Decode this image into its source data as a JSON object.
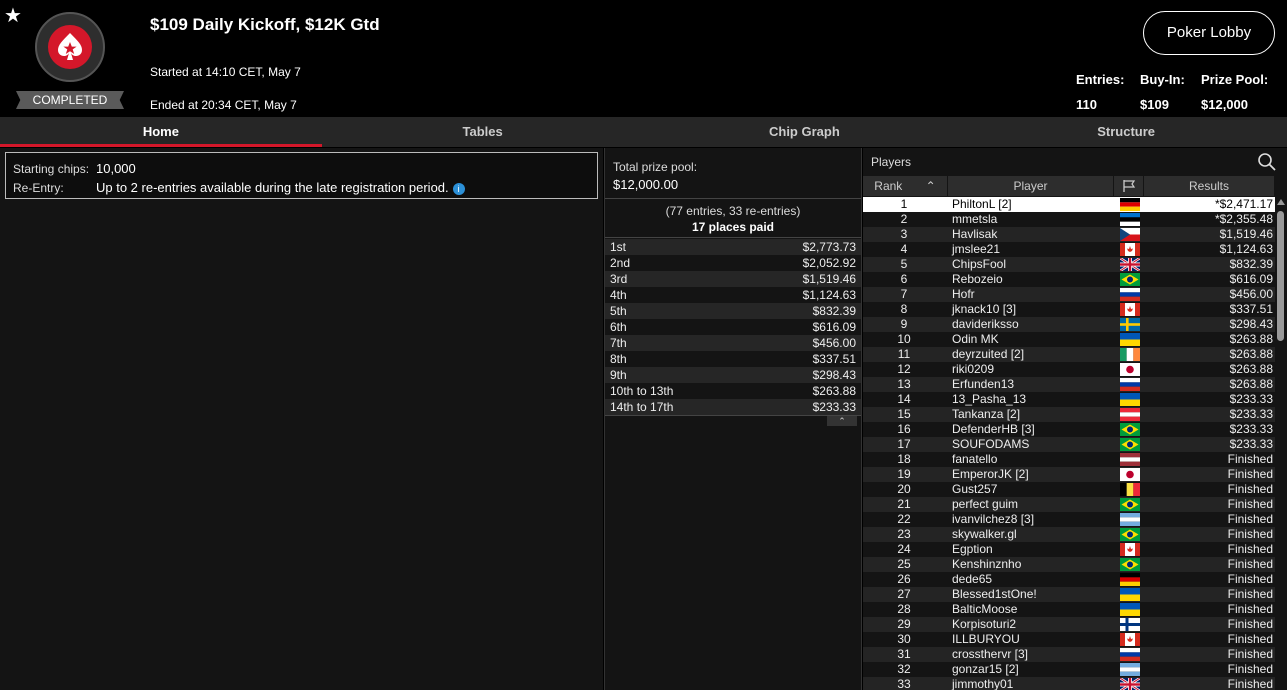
{
  "header": {
    "title": "$109 Daily Kickoff, $12K Gtd",
    "status": "COMPLETED",
    "started": "Started at 14:10 CET, May 7",
    "ended": "Ended at 20:34 CET, May 7",
    "lobby_button": "Poker Lobby",
    "stats": [
      {
        "label": "Entries:",
        "value": "110"
      },
      {
        "label": "Buy-In:",
        "value": "$109"
      },
      {
        "label": "Prize Pool:",
        "value": "$12,000"
      }
    ]
  },
  "tabs": [
    "Home",
    "Tables",
    "Chip Graph",
    "Structure"
  ],
  "info": {
    "starting_chips_label": "Starting chips:",
    "starting_chips_value": "10,000",
    "reentry_label": "Re-Entry:",
    "reentry_value": "Up to 2 re-entries available during the late registration period.",
    "info_icon": "i"
  },
  "prizes": {
    "total_label": "Total prize pool:",
    "total_value": "$12,000.00",
    "entries_text": "(77 entries, 33 re-entries)",
    "places_text": "17 places paid",
    "payouts": [
      {
        "place": "1st",
        "amount": "$2,773.73"
      },
      {
        "place": "2nd",
        "amount": "$2,052.92"
      },
      {
        "place": "3rd",
        "amount": "$1,519.46"
      },
      {
        "place": "4th",
        "amount": "$1,124.63"
      },
      {
        "place": "5th",
        "amount": "$832.39"
      },
      {
        "place": "6th",
        "amount": "$616.09"
      },
      {
        "place": "7th",
        "amount": "$456.00"
      },
      {
        "place": "8th",
        "amount": "$337.51"
      },
      {
        "place": "9th",
        "amount": "$298.43"
      },
      {
        "place": "10th to 13th",
        "amount": "$263.88"
      },
      {
        "place": "14th to 17th",
        "amount": "$233.33"
      }
    ]
  },
  "players": {
    "title": "Players",
    "columns": {
      "rank": "Rank",
      "player": "Player",
      "results": "Results"
    },
    "rows": [
      {
        "rank": "1",
        "name": "PhiltonL [2]",
        "flag": "de",
        "result": "*$2,471.17"
      },
      {
        "rank": "2",
        "name": "mmetsla",
        "flag": "ee",
        "result": "*$2,355.48"
      },
      {
        "rank": "3",
        "name": "Havlisak",
        "flag": "cz",
        "result": "$1,519.46"
      },
      {
        "rank": "4",
        "name": "jmslee21",
        "flag": "ca",
        "result": "$1,124.63"
      },
      {
        "rank": "5",
        "name": "ChipsFool",
        "flag": "gb",
        "result": "$832.39"
      },
      {
        "rank": "6",
        "name": "Rebozeio",
        "flag": "br",
        "result": "$616.09"
      },
      {
        "rank": "7",
        "name": "Hofr",
        "flag": "ru",
        "result": "$456.00"
      },
      {
        "rank": "8",
        "name": "jknack10 [3]",
        "flag": "ca",
        "result": "$337.51"
      },
      {
        "rank": "9",
        "name": "davideriksso",
        "flag": "se",
        "result": "$298.43"
      },
      {
        "rank": "10",
        "name": "Odin MK",
        "flag": "ua",
        "result": "$263.88"
      },
      {
        "rank": "11",
        "name": "deyrzuited [2]",
        "flag": "ie",
        "result": "$263.88"
      },
      {
        "rank": "12",
        "name": "riki0209",
        "flag": "jp",
        "result": "$263.88"
      },
      {
        "rank": "13",
        "name": "Erfunden13",
        "flag": "ru",
        "result": "$263.88"
      },
      {
        "rank": "14",
        "name": "13_Pasha_13",
        "flag": "ua",
        "result": "$233.33"
      },
      {
        "rank": "15",
        "name": "Tankanza [2]",
        "flag": "at",
        "result": "$233.33"
      },
      {
        "rank": "16",
        "name": "DefenderHB [3]",
        "flag": "br",
        "result": "$233.33"
      },
      {
        "rank": "17",
        "name": "SOUFODAMS",
        "flag": "br",
        "result": "$233.33"
      },
      {
        "rank": "18",
        "name": "fanatello",
        "flag": "lv",
        "result": "Finished"
      },
      {
        "rank": "19",
        "name": "EmperorJK [2]",
        "flag": "jp",
        "result": "Finished"
      },
      {
        "rank": "20",
        "name": "Gust257",
        "flag": "be",
        "result": "Finished"
      },
      {
        "rank": "21",
        "name": "perfect guim",
        "flag": "br",
        "result": "Finished"
      },
      {
        "rank": "22",
        "name": "ivanvilchez8 [3]",
        "flag": "ar",
        "result": "Finished"
      },
      {
        "rank": "23",
        "name": "skywalker.gl",
        "flag": "br",
        "result": "Finished"
      },
      {
        "rank": "24",
        "name": "Egption",
        "flag": "ca",
        "result": "Finished"
      },
      {
        "rank": "25",
        "name": "Kenshinznho",
        "flag": "br",
        "result": "Finished"
      },
      {
        "rank": "26",
        "name": "dede65",
        "flag": "de",
        "result": "Finished"
      },
      {
        "rank": "27",
        "name": "Blessed1stOne!",
        "flag": "ua",
        "result": "Finished"
      },
      {
        "rank": "28",
        "name": "BalticMoose",
        "flag": "ua",
        "result": "Finished"
      },
      {
        "rank": "29",
        "name": "Korpisoturi2",
        "flag": "fi",
        "result": "Finished"
      },
      {
        "rank": "30",
        "name": "ILLBURYOU",
        "flag": "ca",
        "result": "Finished"
      },
      {
        "rank": "31",
        "name": "crossthervr [3]",
        "flag": "ru",
        "result": "Finished"
      },
      {
        "rank": "32",
        "name": "gonzar15 [2]",
        "flag": "ar",
        "result": "Finished"
      },
      {
        "rank": "33",
        "name": "jimmothy01",
        "flag": "gb",
        "result": "Finished"
      }
    ]
  },
  "colors": {
    "accent": "#d4172a",
    "background": "#000000",
    "panel": "#141414"
  }
}
